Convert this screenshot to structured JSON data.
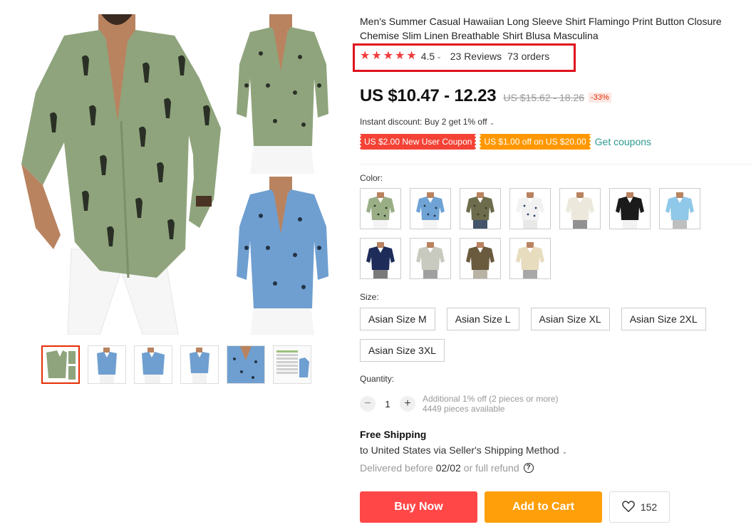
{
  "product": {
    "title": "Men's Summer Casual Hawaiian Long Sleeve Shirt Flamingo Print Button Closure Chemise Slim Linen Breathable Shirt Blusa Masculina",
    "rating": "4.5",
    "stars": 5,
    "reviews": "23 Reviews",
    "orders": "73 orders",
    "price": "US $10.47 - 12.23",
    "old_price": "US $15.62 - 18.26",
    "discount": "-33%",
    "instant_discount": "Instant discount: Buy 2 get 1% off"
  },
  "coupons": [
    {
      "label": "US $2.00 New User Coupon",
      "color": "#f44336"
    },
    {
      "label": "US $1.00 off on US $20.00",
      "color": "#ff9800"
    }
  ],
  "get_coupons": "Get coupons",
  "color_label": "Color:",
  "colors": [
    {
      "shirt": "#9aae86",
      "pants": "#f4f4f4",
      "print": "#2b3327"
    },
    {
      "shirt": "#6fa3d6",
      "pants": "#f4f4f4",
      "print": "#223344"
    },
    {
      "shirt": "#6d6d4d",
      "pants": "#44546a",
      "print": "#3b3b2b"
    },
    {
      "shirt": "#f2f2f2",
      "pants": "#e8e8e8",
      "print": "#2a3c6e"
    },
    {
      "shirt": "#ece8dc",
      "pants": "#909090",
      "print": "#ece8dc"
    },
    {
      "shirt": "#1b1b1b",
      "pants": "#f2f2f2",
      "print": "#1b1b1b"
    },
    {
      "shirt": "#8fc8e8",
      "pants": "#bfbfbf",
      "print": "#8fc8e8"
    },
    {
      "shirt": "#1e2c5a",
      "pants": "#7a7a7a",
      "print": "#1e2c5a"
    },
    {
      "shirt": "#c9cabf",
      "pants": "#a0a0a0",
      "print": "#c9cabf"
    },
    {
      "shirt": "#6b5b3e",
      "pants": "#b9b3a6",
      "print": "#6b5b3e"
    },
    {
      "shirt": "#e8dcbf",
      "pants": "#a8a8a8",
      "print": "#e8dcbf"
    }
  ],
  "size_label": "Size:",
  "sizes": [
    "Asian Size M",
    "Asian Size L",
    "Asian Size XL",
    "Asian Size 2XL",
    "Asian Size 3XL"
  ],
  "quantity": {
    "label": "Quantity:",
    "value": "1",
    "minus": "−",
    "plus": "+",
    "note1": "Additional 1% off (2 pieces or more)",
    "note2": "4449 pieces available"
  },
  "shipping": {
    "title": "Free Shipping",
    "method": "to United States via Seller's Shipping Method",
    "delivery_prefix": "Delivered before",
    "delivery_date": "02/02",
    "delivery_suffix": "or full refund"
  },
  "actions": {
    "buy_now": "Buy Now",
    "add_to_cart": "Add to Cart",
    "wishlist_count": "152"
  },
  "thumbnails": [
    {
      "kind": "green-collage",
      "active": true
    },
    {
      "kind": "blue"
    },
    {
      "kind": "blue-side"
    },
    {
      "kind": "blue"
    },
    {
      "kind": "blue-closeup"
    },
    {
      "kind": "size-chart"
    }
  ],
  "gallery_colors": {
    "green": "#8fa47c",
    "blue": "#6f9fd0",
    "print": "#2a3026",
    "skin": "#b98360",
    "pants": "#f6f6f6",
    "highlight": "#e0121c"
  }
}
